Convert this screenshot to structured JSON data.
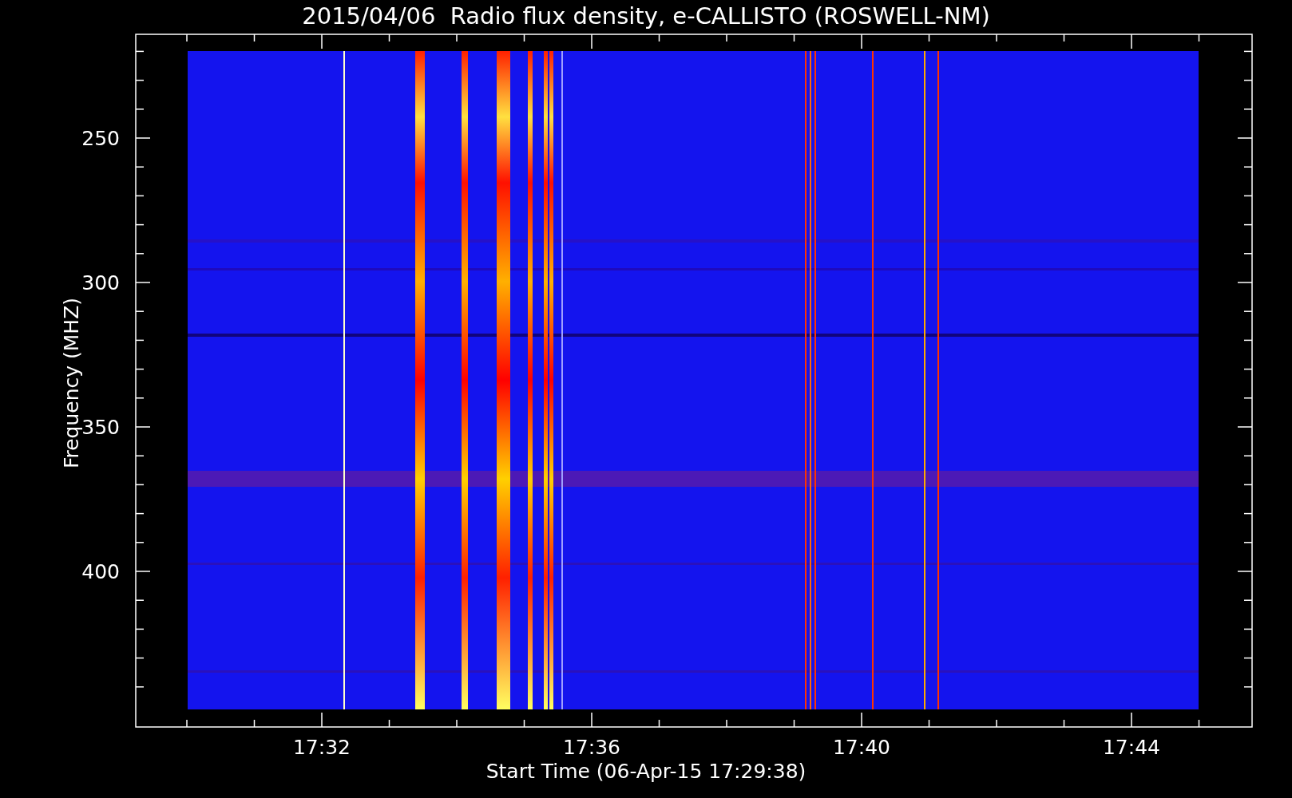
{
  "chart": {
    "title": "2015/04/06  Radio flux density, e-CALLISTO (ROSWELL-NM)",
    "ylabel": "Frequency (MHZ)",
    "xlabel": "Start Time (06-Apr-15 17:29:38)",
    "yticks": [
      "250",
      "300",
      "350",
      "400"
    ],
    "xticks": [
      "17:32",
      "17:36",
      "17:40",
      "17:44"
    ]
  }
}
